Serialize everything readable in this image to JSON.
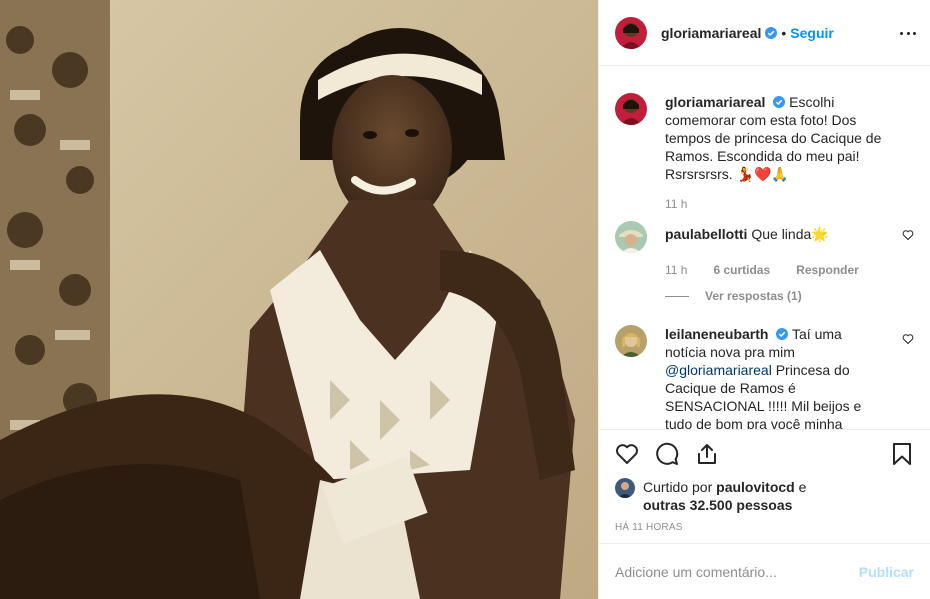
{
  "post": {
    "author": "gloriamariareal",
    "follow_label": "Seguir",
    "separator": "•"
  },
  "caption": {
    "username": "gloriamariareal",
    "text": "Escolhi comemorar com esta foto! Dos tempos de princesa do Cacique de Ramos. Escondida do meu pai! Rsrsrsrsrs. 💃❤️🙏",
    "time": "11 h"
  },
  "comments": [
    {
      "username": "paulabellotti",
      "text": "Que linda🌟",
      "time": "11 h",
      "likes": "6 curtidas",
      "reply_label": "Responder",
      "view_replies": "Ver respostas (1)"
    },
    {
      "username": "leilaneneubarth",
      "text_before": "Taí uma notícia nova pra mim ",
      "mention": "@gloriamariareal",
      "text_after": " Princesa do Cacique de Ramos é SENSACIONAL !!!!! Mil beijos e tudo de bom pra você minha"
    }
  ],
  "liked_by": {
    "prefix": "Curtido por ",
    "user": "paulovitocd",
    "suffix": " e",
    "others": "outras 32.500 pessoas"
  },
  "timestamp": "HÁ 11 HORAS",
  "add_comment": {
    "placeholder": "Adicione um comentário...",
    "publish_label": "Publicar"
  },
  "colors": {
    "link_blue": "#0095f6",
    "publish_disabled": "#b2dffc",
    "verified": "#3897f0"
  },
  "icons": [
    "verified-badge-icon",
    "more-options-icon",
    "heart-icon",
    "comment-icon",
    "share-icon",
    "bookmark-icon"
  ]
}
